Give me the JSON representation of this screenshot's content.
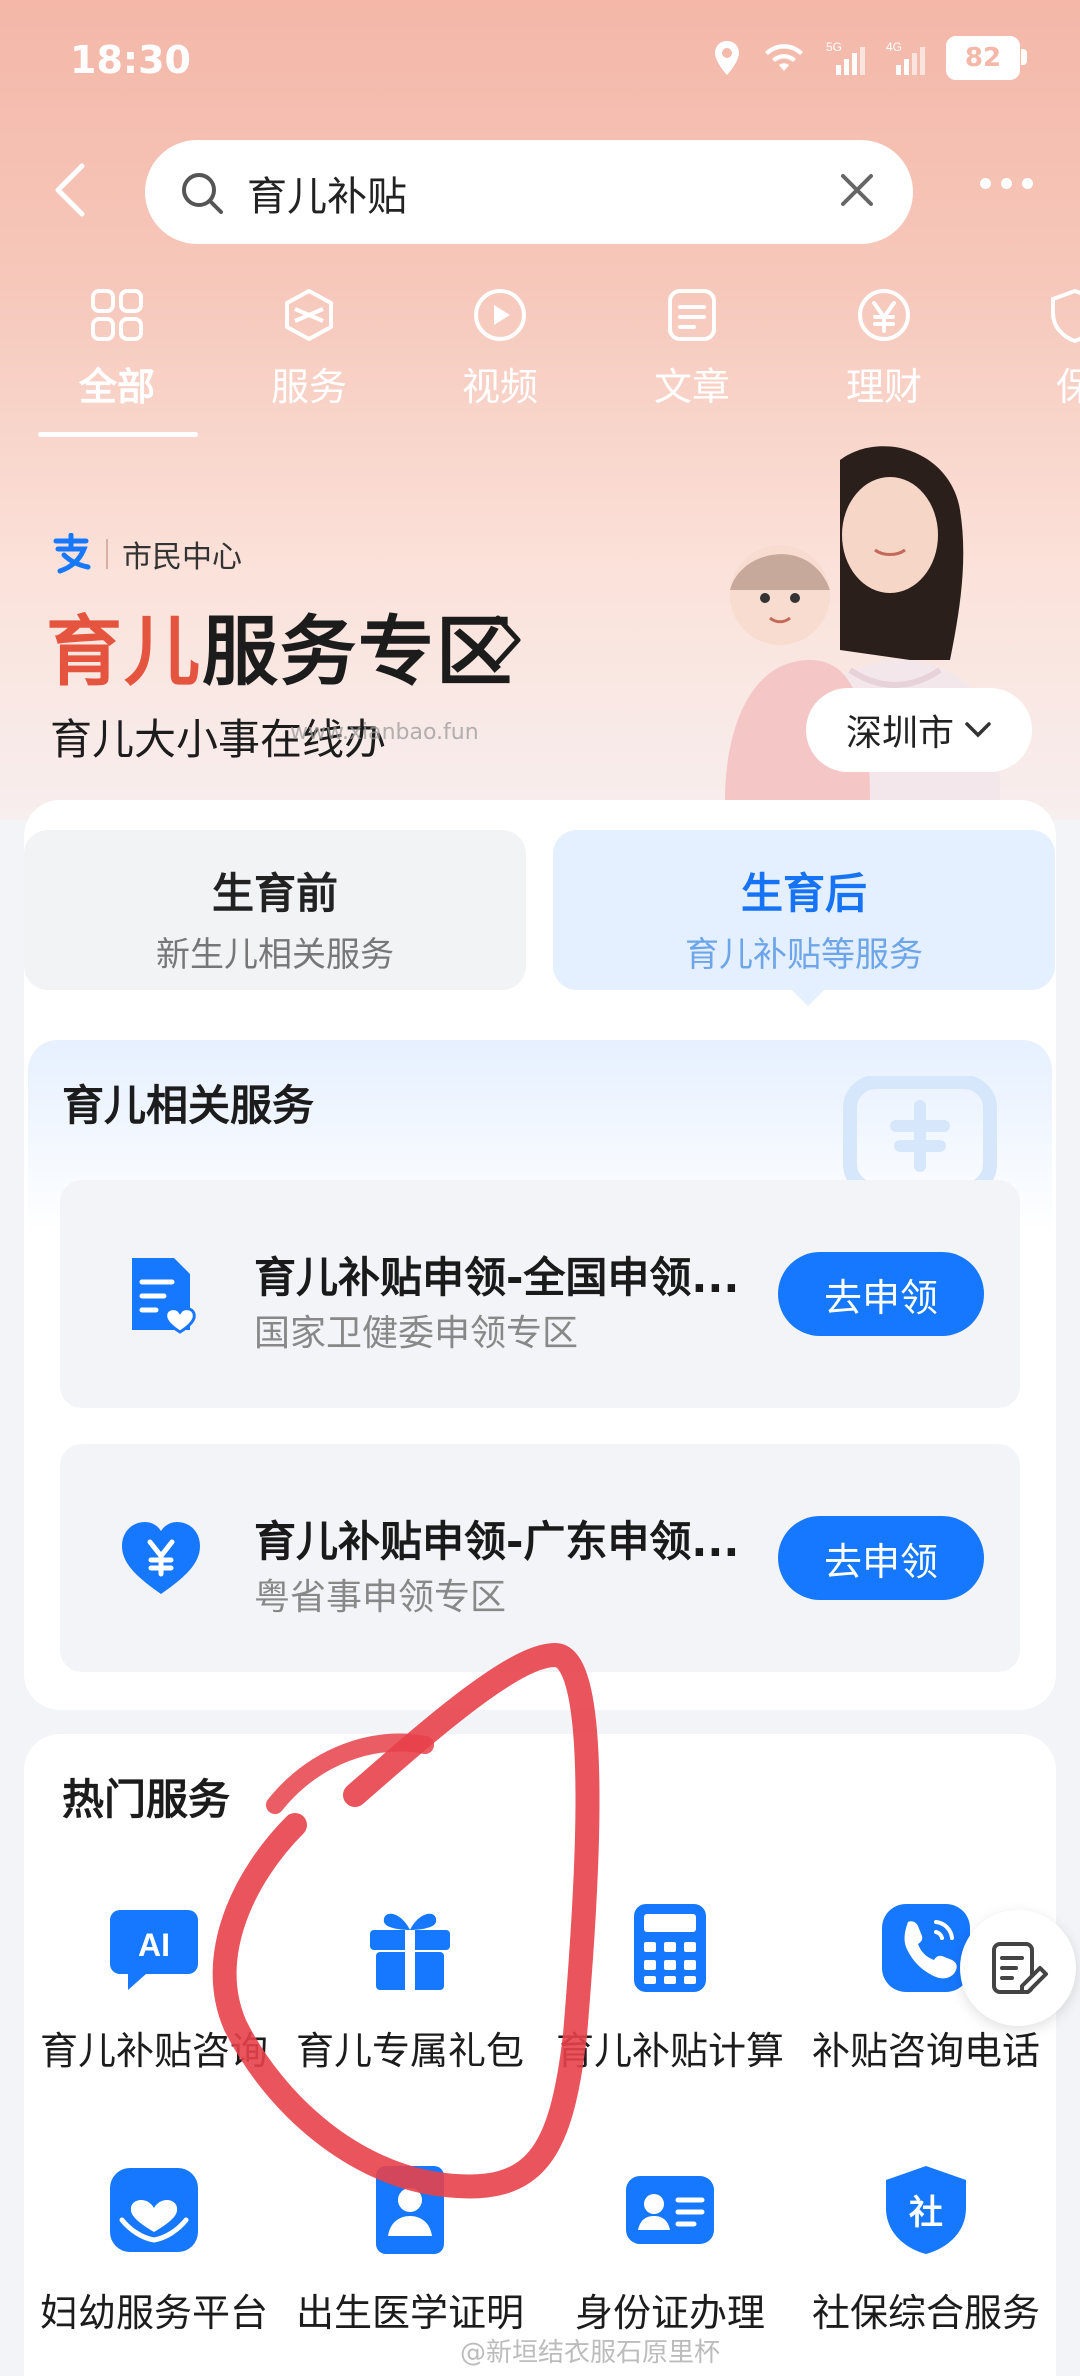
{
  "status_bar": {
    "time": "18:30",
    "battery": "82",
    "net1": "5G",
    "net2": "4G"
  },
  "search": {
    "query": "育儿补贴"
  },
  "tabs": [
    {
      "label": "全部",
      "icon": "grid-icon",
      "active": true
    },
    {
      "label": "服务",
      "icon": "cube-icon"
    },
    {
      "label": "视频",
      "icon": "play-icon"
    },
    {
      "label": "文章",
      "icon": "document-icon"
    },
    {
      "label": "理财",
      "icon": "yen-icon"
    },
    {
      "label": "保",
      "icon": "shield-icon"
    }
  ],
  "zone": {
    "brand": "市民中心",
    "title_red": "育儿",
    "title_dark": "服务专区",
    "subtitle": "育儿大小事在线办",
    "city": "深圳市",
    "watermark": "www.xianbao.fun"
  },
  "segments": [
    {
      "title": "生育前",
      "subtitle": "新生儿相关服务",
      "active": false
    },
    {
      "title": "生育后",
      "subtitle": "育儿补贴等服务",
      "active": true
    }
  ],
  "related": {
    "title": "育儿相关服务",
    "items": [
      {
        "title": "育儿补贴申领-全国申领...",
        "subtitle": "国家卫健委申领专区",
        "button": "去申领",
        "icon": "document-heart-icon"
      },
      {
        "title": "育儿补贴申领-广东申领...",
        "subtitle": "粤省事申领专区",
        "button": "去申领",
        "icon": "heart-yen-icon"
      }
    ]
  },
  "hot": {
    "title": "热门服务",
    "items": [
      {
        "label": "育儿补贴咨询",
        "icon": "ai-chat-icon"
      },
      {
        "label": "育儿专属礼包",
        "icon": "gift-icon"
      },
      {
        "label": "育儿补贴计算",
        "icon": "calculator-icon"
      },
      {
        "label": "补贴咨询电话",
        "icon": "phone-icon"
      },
      {
        "label": "妇幼服务平台",
        "icon": "hands-heart-icon"
      },
      {
        "label": "出生医学证明",
        "icon": "certificate-icon"
      },
      {
        "label": "身份证办理",
        "icon": "id-card-icon"
      },
      {
        "label": "社保综合服务",
        "icon": "social-security-icon"
      }
    ]
  },
  "footer_watermark": "@新垣结衣服石原里杯",
  "colors": {
    "accent": "#1677ff",
    "brand_red": "#e4543f",
    "annotation": "#e8414a"
  }
}
